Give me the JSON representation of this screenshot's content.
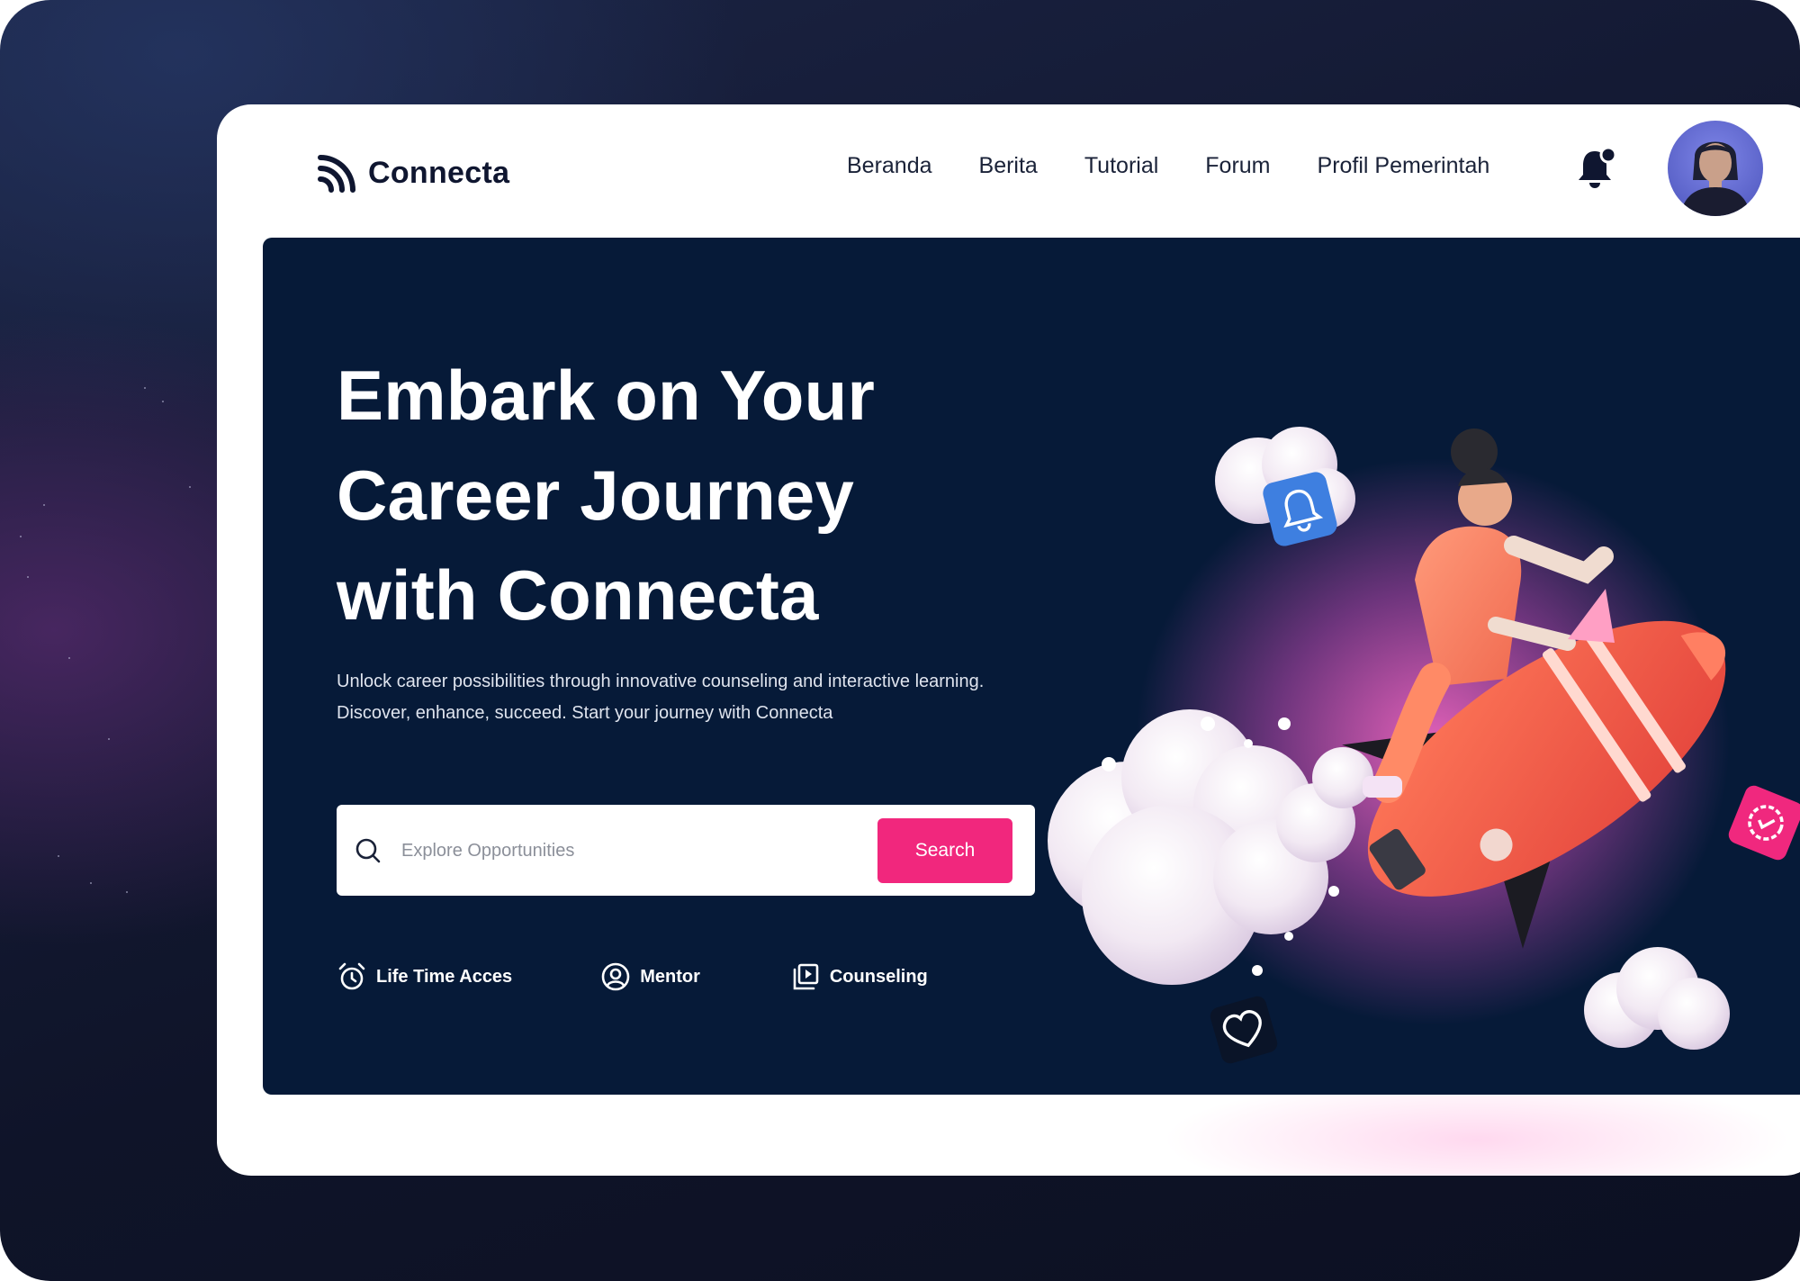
{
  "brand": {
    "name": "Connecta"
  },
  "nav": {
    "items": [
      "Beranda",
      "Berita",
      "Tutorial",
      "Forum",
      "Profil Pemerintah"
    ]
  },
  "icons": {
    "logo": "logo-mark-icon",
    "notification": "bell-icon",
    "search": "search-icon",
    "features": [
      "alarm-clock-icon",
      "user-circle-icon",
      "play-library-icon"
    ]
  },
  "hero": {
    "headline_lines": [
      "Embark on Your",
      "Career Journey",
      "with Connecta"
    ],
    "subtitle": "Unlock career possibilities through innovative counseling and interactive learning. Discover, enhance, succeed. Start your journey with Connecta",
    "search": {
      "placeholder": "Explore Opportunities",
      "button_label": "Search"
    },
    "features": [
      {
        "label": "Life Time Acces"
      },
      {
        "label": "Mentor"
      },
      {
        "label": "Counseling"
      }
    ]
  },
  "colors": {
    "hero_bg": "#061a38",
    "accent": "#f1277d",
    "brand_text": "#0f1630",
    "floating_bell_tile": "#3e7fe0",
    "floating_badge_tile": "#f0287e"
  }
}
